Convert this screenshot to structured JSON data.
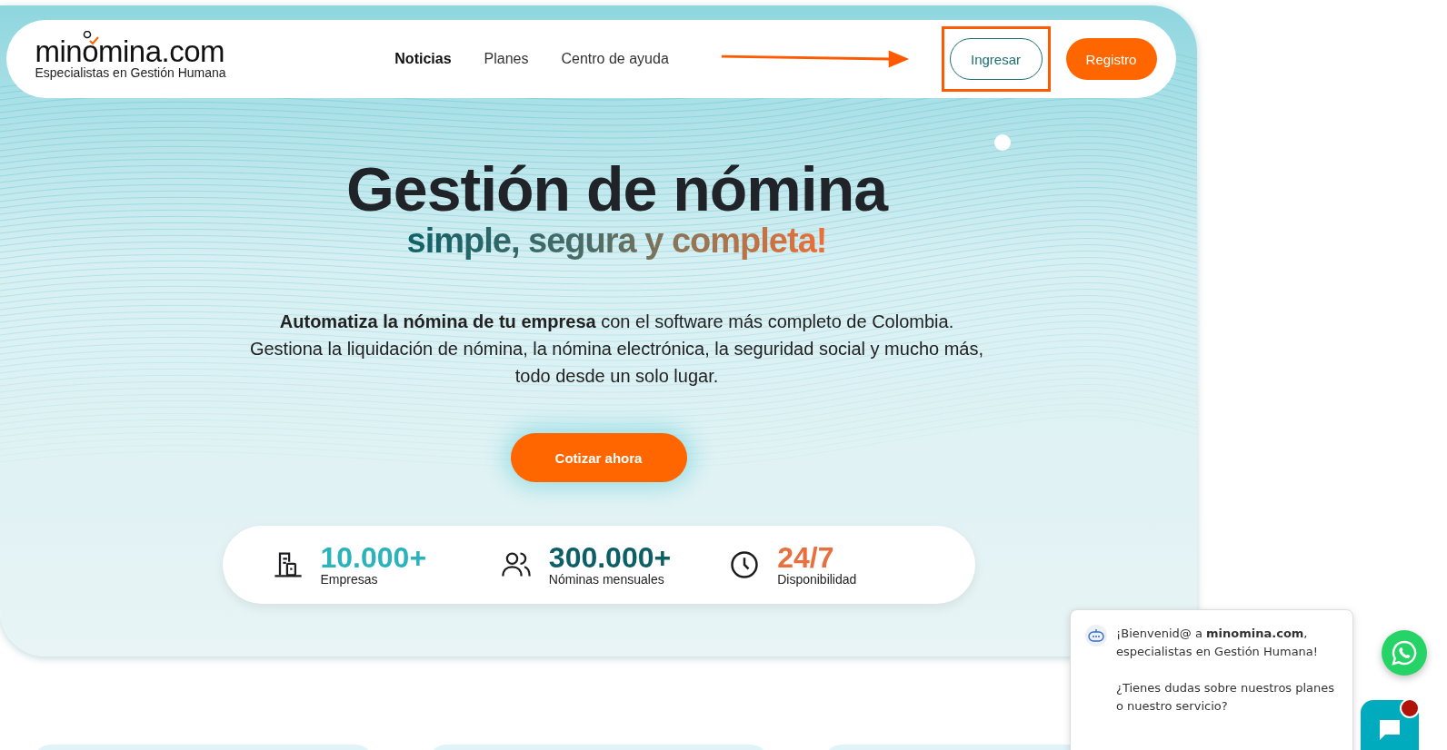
{
  "header": {
    "logo": {
      "name": "minomina.com",
      "tagline": "Especialistas en Gestión Humana"
    },
    "nav": [
      {
        "label": "Noticias",
        "selected": true
      },
      {
        "label": "Planes",
        "selected": false
      },
      {
        "label": "Centro de ayuda",
        "selected": false
      }
    ],
    "buttons": [
      {
        "label": "Ingresar",
        "kind": "outline",
        "highlighted": true
      },
      {
        "label": "Registro",
        "kind": "filled",
        "highlighted": false
      }
    ]
  },
  "hero": {
    "title": "Gestión de nómina",
    "subtitle": "simple, segura y completa!",
    "description": "**Automatiza la nómina de tu empresa** con el software más completo de Colombia. Gestiona la liquidación de nómina, la nómina electrónica, la seguridad social y mucho más, todo desde un solo lugar.",
    "cta": "Cotizar ahora"
  },
  "stats": [
    {
      "kind": "building",
      "value": "10.000+",
      "label": "Empresas",
      "color": "#2ab3bb"
    },
    {
      "kind": "people",
      "value": "300.000+",
      "label": "Nóminas mensuales",
      "color": "#0d5f66"
    },
    {
      "kind": "clock",
      "value": "24/7",
      "label": "Disponibilidad",
      "color": "#e8703e"
    }
  ],
  "chat": {
    "messages": [
      "¡Bienvenid@ a **minomina.com**, especialistas en Gestión Humana!",
      "¿Tienes dudas sobre nuestros planes o nuestro servicio?"
    ],
    "unread": true
  }
}
